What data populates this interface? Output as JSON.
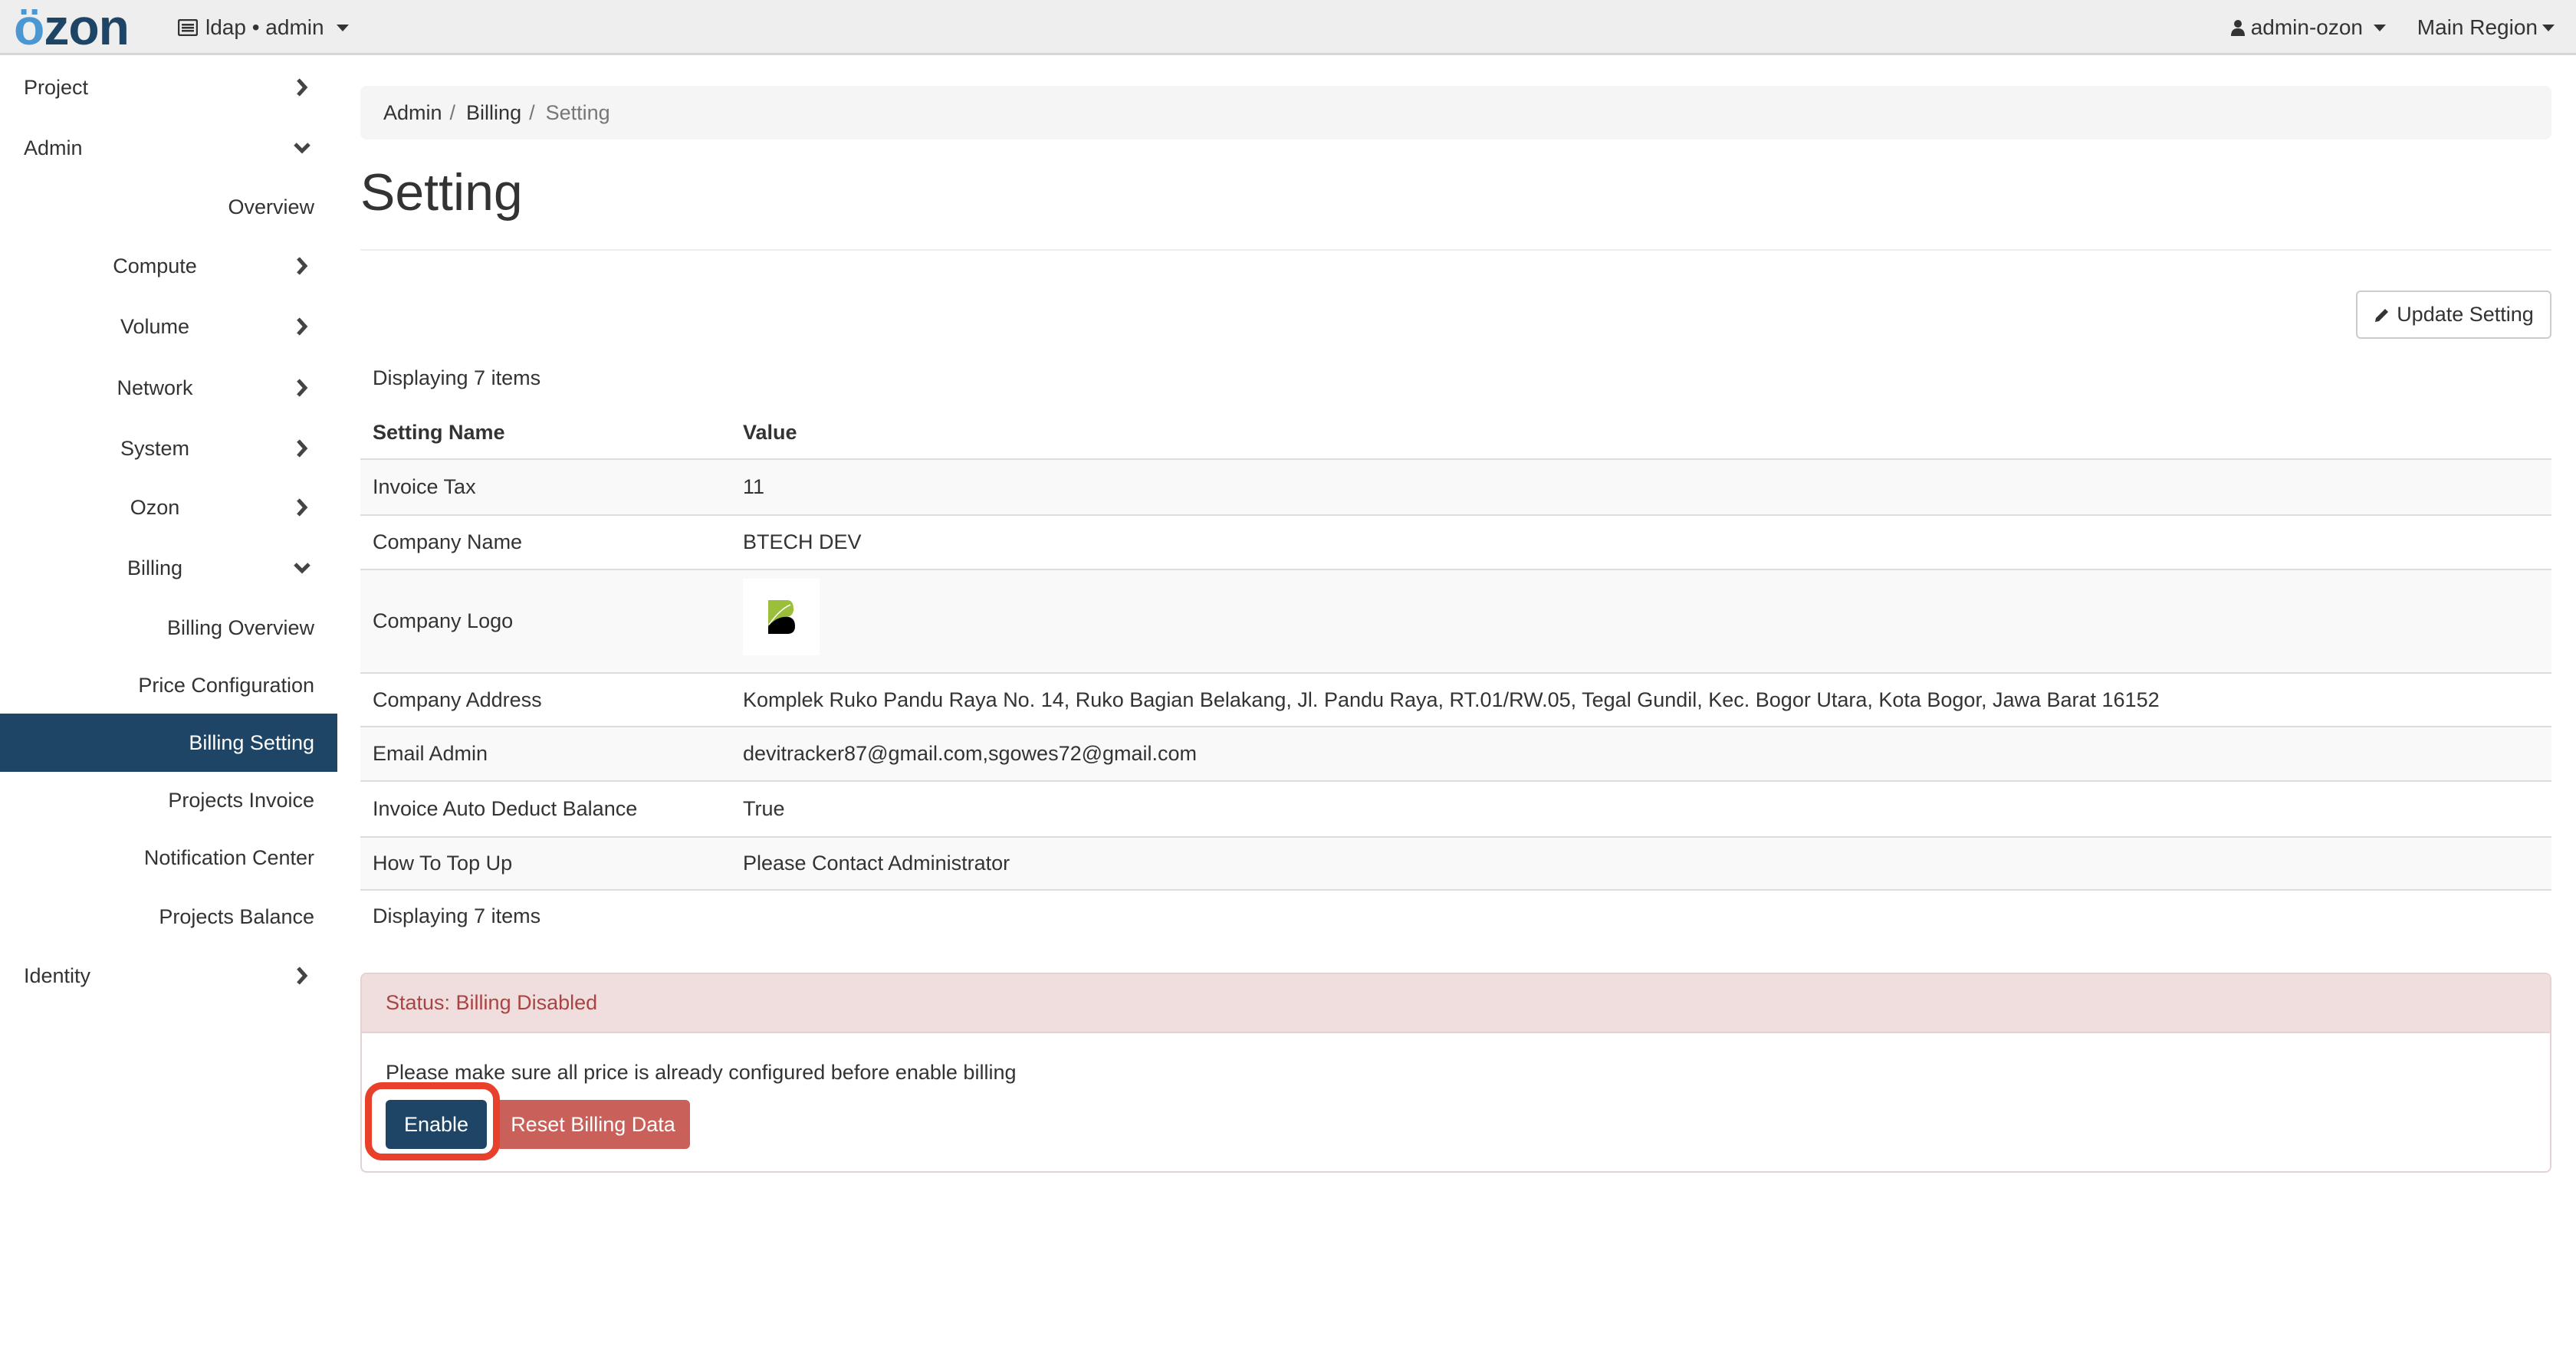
{
  "header": {
    "logo": "özon",
    "project_selector": "ldap • admin",
    "user_menu": "admin-ozon",
    "region_menu": "Main Region"
  },
  "sidebar": {
    "items": [
      {
        "label": "Project",
        "level": 1,
        "icon": "chevron-right-icon"
      },
      {
        "label": "Admin",
        "level": 1,
        "icon": "chevron-down-icon"
      },
      {
        "label": "Overview",
        "level": 3
      },
      {
        "label": "Compute",
        "level": 2,
        "icon": "chevron-right-icon"
      },
      {
        "label": "Volume",
        "level": 2,
        "icon": "chevron-right-icon"
      },
      {
        "label": "Network",
        "level": 2,
        "icon": "chevron-right-icon"
      },
      {
        "label": "System",
        "level": 2,
        "icon": "chevron-right-icon"
      },
      {
        "label": "Ozon",
        "level": 2,
        "icon": "chevron-right-icon"
      },
      {
        "label": "Billing",
        "level": 2,
        "icon": "chevron-down-icon"
      },
      {
        "label": "Billing Overview",
        "level": 3
      },
      {
        "label": "Price Configuration",
        "level": 3
      },
      {
        "label": "Billing Setting",
        "level": 3,
        "active": true
      },
      {
        "label": "Projects Invoice",
        "level": 3
      },
      {
        "label": "Notification Center",
        "level": 3
      },
      {
        "label": "Projects Balance",
        "level": 3
      },
      {
        "label": "Identity",
        "level": 1,
        "icon": "chevron-right-icon"
      }
    ]
  },
  "breadcrumb": [
    "Admin",
    "Billing",
    "Setting"
  ],
  "page_title": "Setting",
  "update_button": "Update Setting",
  "table": {
    "count_label": "Displaying 7 items",
    "headers": [
      "Setting Name",
      "Value"
    ],
    "rows": [
      [
        "Invoice Tax",
        "11"
      ],
      [
        "Company Name",
        "BTECH DEV"
      ],
      [
        "Company Logo",
        ""
      ],
      [
        "Company Address",
        "Komplek Ruko Pandu Raya No. 14, Ruko Bagian Belakang, Jl. Pandu Raya, RT.01/RW.05, Tegal Gundil, Kec. Bogor Utara, Kota Bogor, Jawa Barat 16152"
      ],
      [
        "Email Admin",
        "devitracker87@gmail.com,sgowes72@gmail.com"
      ],
      [
        "Invoice Auto Deduct Balance",
        "True"
      ],
      [
        "How To Top Up",
        "Please Contact Administrator"
      ]
    ]
  },
  "status_panel": {
    "heading": "Status: Billing Disabled",
    "message": "Please make sure all price is already configured before enable billing",
    "enable_button": "Enable",
    "reset_button": "Reset Billing Data"
  },
  "colors": {
    "brand": "#1f4566",
    "logo_accent": "#4a97d1",
    "danger": "#c9605a",
    "highlight": "#e8402a"
  }
}
